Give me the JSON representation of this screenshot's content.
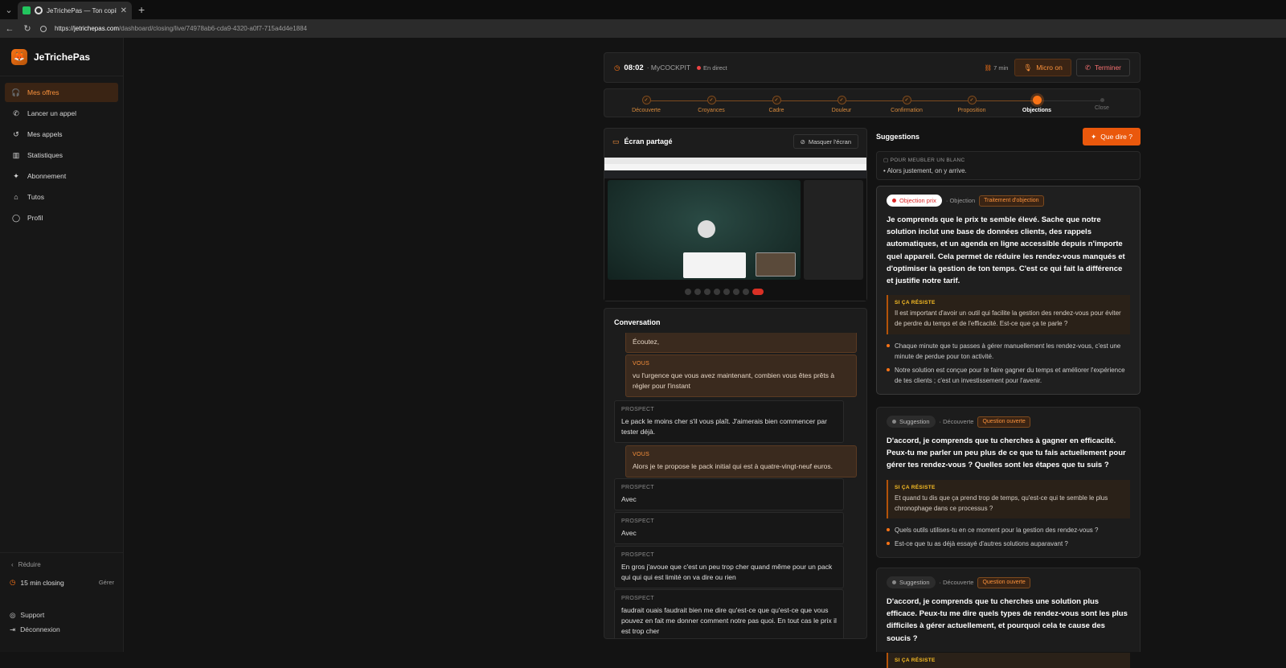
{
  "browser": {
    "tab_title": "JeTrichePas — Ton copilote IA",
    "url_prefix": "https://",
    "url_host": "jetrichepas.com",
    "url_path": "/dashboard/closing/live/74978ab6-cda9-4320-a0f7-715a4d4e1884"
  },
  "sidebar": {
    "brand": "JeTrichePas",
    "items": [
      {
        "label": "Mes offres",
        "icon": "headset-icon"
      },
      {
        "label": "Lancer un appel",
        "icon": "phone-icon"
      },
      {
        "label": "Mes appels",
        "icon": "history-icon"
      },
      {
        "label": "Statistiques",
        "icon": "bar-chart-icon"
      },
      {
        "label": "Abonnement",
        "icon": "sparkle-icon"
      },
      {
        "label": "Tutos",
        "icon": "graduation-cap-icon"
      },
      {
        "label": "Profil",
        "icon": "user-icon"
      }
    ],
    "reduce": "Réduire",
    "plan": "15 min closing",
    "plan_manage": "Gérer",
    "support": "Support",
    "logout": "Déconnexion"
  },
  "session": {
    "timer": "08:02",
    "name": "· MyCOCKPIT",
    "status": "En direct",
    "duration": "7 min",
    "mic_label": "Micro on",
    "end_label": "Terminer"
  },
  "steps": [
    {
      "label": "Découverte",
      "state": "done"
    },
    {
      "label": "Croyances",
      "state": "done"
    },
    {
      "label": "Cadre",
      "state": "done"
    },
    {
      "label": "Douleur",
      "state": "done"
    },
    {
      "label": "Confirmation",
      "state": "done"
    },
    {
      "label": "Proposition",
      "state": "done"
    },
    {
      "label": "Objections",
      "state": "current"
    },
    {
      "label": "Close",
      "state": "todo"
    }
  ],
  "screen": {
    "title": "Écran partagé",
    "hide_label": "Masquer l'écran"
  },
  "conversation": {
    "title": "Conversation",
    "messages": [
      {
        "speaker": "VOUS",
        "role": "you",
        "text": "Écoutez,"
      },
      {
        "speaker": "VOUS",
        "role": "you",
        "text": "vu l'urgence que vous avez maintenant, combien vous êtes prêts à régler pour l'instant"
      },
      {
        "speaker": "PROSPECT",
        "role": "pro",
        "text": "Le pack le moins cher s'il vous plaît. J'aimerais bien commencer par tester déjà."
      },
      {
        "speaker": "VOUS",
        "role": "you",
        "text": "Alors je te propose le pack initial qui est à quatre-vingt-neuf euros."
      },
      {
        "speaker": "PROSPECT",
        "role": "pro",
        "text": "Avec"
      },
      {
        "speaker": "PROSPECT",
        "role": "pro",
        "text": "Avec"
      },
      {
        "speaker": "PROSPECT",
        "role": "pro",
        "text": "En gros j'avoue que c'est un peu trop cher quand même pour un pack qui qui qui est limité on va dire ou rien"
      },
      {
        "speaker": "PROSPECT",
        "role": "pro",
        "text": "faudrait ouais faudrait bien me dire qu'est-ce que qu'est-ce que vous pouvez en fait me donner comment notre pas quoi. En tout cas le prix il est trop cher"
      }
    ]
  },
  "suggestions": {
    "title": "Suggestions",
    "ask_label": "Que dire ?",
    "filler_key": "POUR MEUBLER UN BLANC",
    "filler_value": "Alors justement, on y arrive.",
    "resist_key": "SI ÇA RÉSISTE",
    "cards": [
      {
        "badge": "Objection prix",
        "badge_style": "red",
        "category": "· Objection",
        "subtag": "Traitement d'objection",
        "main": "Je comprends que le prix te semble élevé. Sache que notre solution inclut une base de données clients, des rappels automatiques, et un agenda en ligne accessible depuis n'importe quel appareil. Cela permet de réduire les rendez-vous manqués et d'optimiser la gestion de ton temps. C'est ce qui fait la différence et justifie notre tarif.",
        "resist": "Il est important d'avoir un outil qui facilite la gestion des rendez-vous pour éviter de perdre du temps et de l'efficacité. Est-ce que ça te parle ?",
        "bullets": [
          "Chaque minute que tu passes à gérer manuellement les rendez-vous, c'est une minute de perdue pour ton activité.",
          "Notre solution est conçue pour te faire gagner du temps et améliorer l'expérience de tes clients ; c'est un investissement pour l'avenir."
        ]
      },
      {
        "badge": "Suggestion",
        "badge_style": "grey",
        "category": "· Découverte",
        "subtag": "Question ouverte",
        "main": "D'accord, je comprends que tu cherches à gagner en efficacité. Peux-tu me parler un peu plus de ce que tu fais actuellement pour gérer tes rendez-vous ? Quelles sont les étapes que tu suis ?",
        "resist": "Et quand tu dis que ça prend trop de temps, qu'est-ce qui te semble le plus chronophage dans ce processus ?",
        "bullets": [
          "Quels outils utilises-tu en ce moment pour la gestion des rendez-vous ?",
          "Est-ce que tu as déjà essayé d'autres solutions auparavant ?"
        ]
      },
      {
        "badge": "Suggestion",
        "badge_style": "grey",
        "category": "· Découverte",
        "subtag": "Question ouverte",
        "main": "D'accord, je comprends que tu cherches une solution plus efficace. Peux-tu me dire quels types de rendez-vous sont les plus difficiles à gérer actuellement, et pourquoi cela te cause des soucis ?",
        "resist": "",
        "bullets": []
      }
    ]
  },
  "colors": {
    "accent": "#f97316",
    "background": "#131313",
    "card": "#1c1c1c"
  }
}
